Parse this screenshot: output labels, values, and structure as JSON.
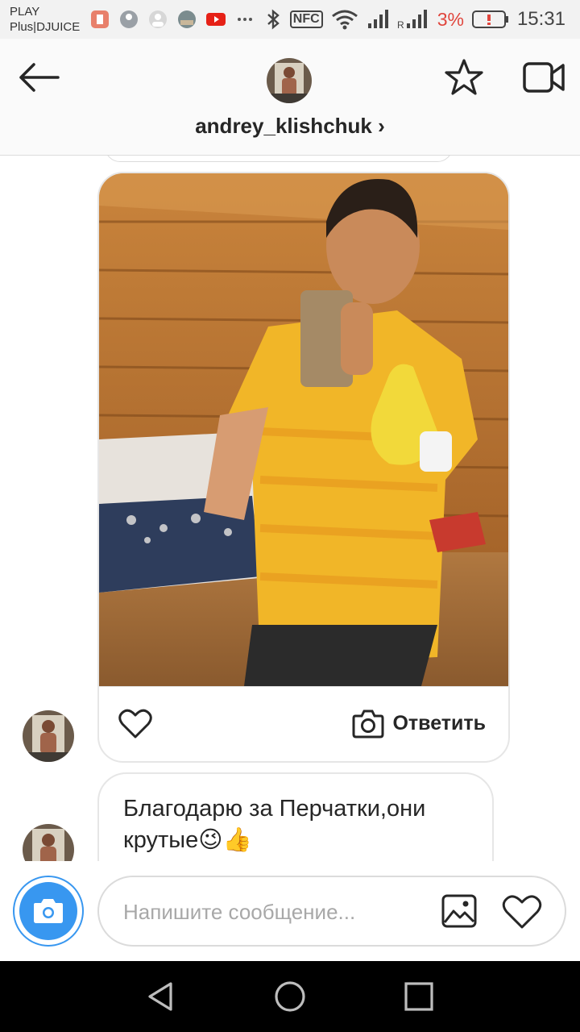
{
  "status_bar": {
    "carrier_line1": "PLAY",
    "carrier_line2": "Plus|DJUICE",
    "battery": "3%",
    "time": "15:31",
    "nfc_label": "NFC"
  },
  "header": {
    "username": "andrey_klishchuk",
    "chevron": "›"
  },
  "messages": {
    "photo_reply_label": "Ответить",
    "text_message": "Благодарю за Перчатки,они крутые😉👍"
  },
  "composer": {
    "placeholder": "Напишите сообщение..."
  },
  "icons": {
    "back": "arrow-left-icon",
    "star": "star-icon",
    "video": "video-call-icon",
    "heart": "heart-icon",
    "camera": "camera-icon",
    "gallery": "gallery-icon"
  },
  "colors": {
    "accent": "#3897f0",
    "battery_low": "#e0463d",
    "border": "#dbdbdb"
  }
}
